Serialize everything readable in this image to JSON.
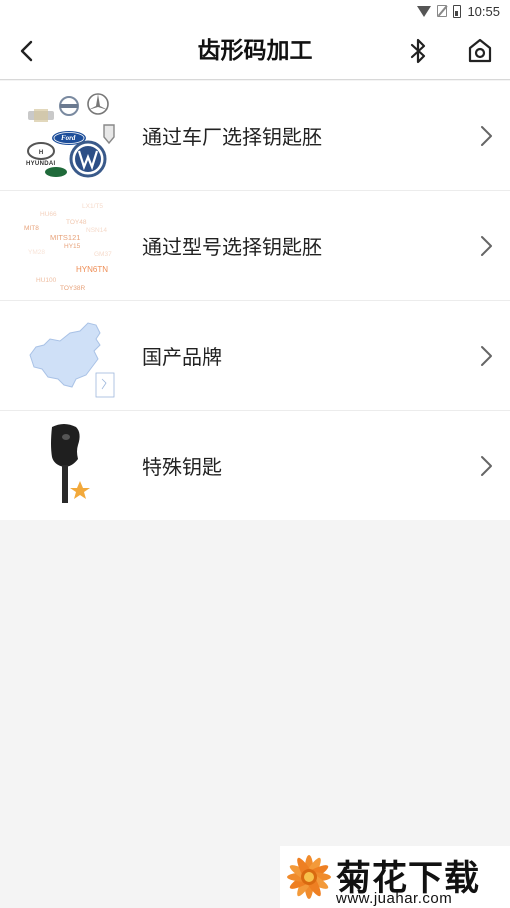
{
  "status_bar": {
    "time": "10:55",
    "icons": [
      "wifi-icon",
      "no-sim-icon",
      "battery-icon"
    ]
  },
  "header": {
    "title": "齿形码加工",
    "back_icon": "chevron-left-icon",
    "bluetooth_icon": "bluetooth-icon",
    "home_icon": "home-icon"
  },
  "menu": {
    "items": [
      {
        "label": "通过车厂选择钥匙胚",
        "icon": "car-brand-logos"
      },
      {
        "label": "通过型号选择钥匙胚",
        "icon": "key-model-codes"
      },
      {
        "label": "国产品牌",
        "icon": "china-map"
      },
      {
        "label": "特殊钥匙",
        "icon": "special-key"
      }
    ]
  },
  "brand_logos": {
    "ford": "Ford",
    "hyundai": "HYUNDAI"
  },
  "model_codes": [
    "HU66",
    "LX1/T5",
    "TOY48",
    "MIT8",
    "MITS121",
    "HY15",
    "HYN6TN",
    "HU100",
    "GM37",
    "YM28",
    "TOY38R",
    "NSN14"
  ],
  "watermark": {
    "title": "菊花下载网",
    "url": "www.juahar.com"
  },
  "colors": {
    "accent_orange": "#f08b2c",
    "map_blue": "#cfe0f7",
    "star_orange": "#f2a93b"
  }
}
